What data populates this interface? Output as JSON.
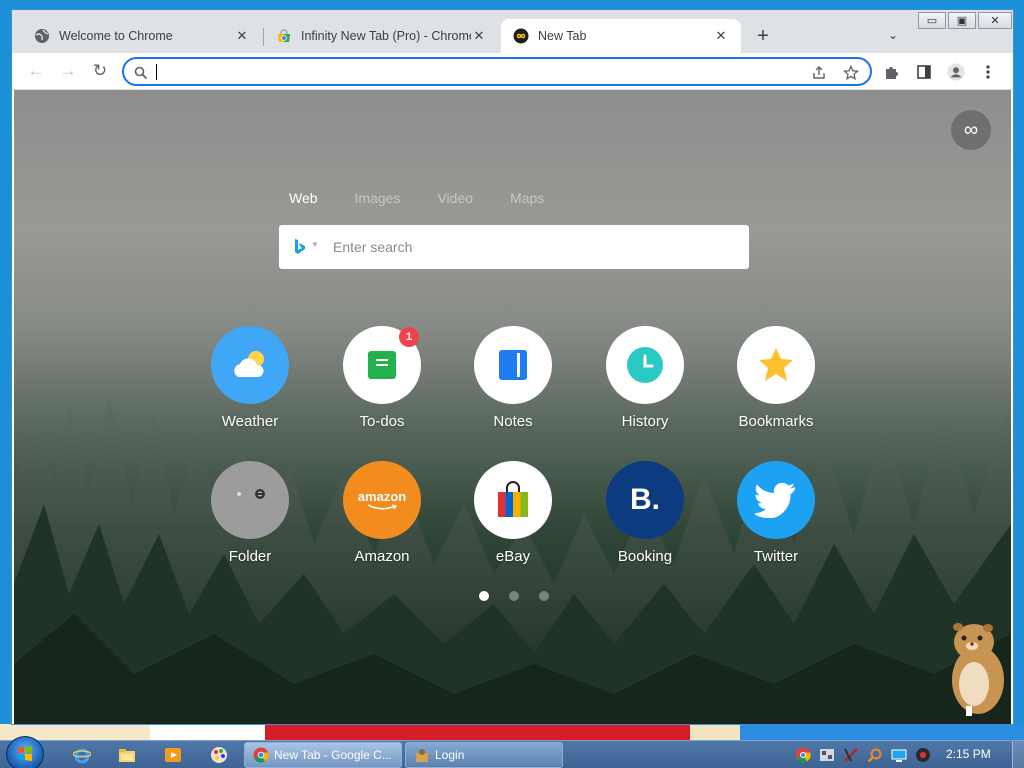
{
  "browser": {
    "tabs": [
      {
        "label": "Welcome to Chrome",
        "icon": "globe-icon"
      },
      {
        "label": "Infinity New Tab (Pro) - Chrome W",
        "icon": "chrome-webstore-icon"
      },
      {
        "label": "New Tab",
        "icon": "infinity-icon",
        "active": true
      }
    ],
    "new_tab_symbol": "+",
    "tab_search_symbol": "⌄",
    "window_controls": {
      "minimize": "▭",
      "maximize": "▣",
      "close": "✕"
    },
    "omnibox": {
      "value": "",
      "placeholder": ""
    }
  },
  "newtab": {
    "search_tabs": [
      "Web",
      "Images",
      "Video",
      "Maps"
    ],
    "active_search_tab": "Web",
    "search_placeholder": "Enter search",
    "infinity_symbol": "∞",
    "tiles": [
      {
        "label": "Weather",
        "icon": "weather-icon",
        "color": "#3fa7f5"
      },
      {
        "label": "To-dos",
        "icon": "todo-icon",
        "color": "#ffffff",
        "badge": "1"
      },
      {
        "label": "Notes",
        "icon": "notes-icon",
        "color": "#ffffff"
      },
      {
        "label": "History",
        "icon": "history-icon",
        "color": "#ffffff"
      },
      {
        "label": "Bookmarks",
        "icon": "bookmark-star-icon",
        "color": "#ffffff"
      },
      {
        "label": "Folder",
        "icon": "folder-icon",
        "color": "#9c9c9c"
      },
      {
        "label": "Amazon",
        "icon": "amazon-icon",
        "color": "#f28c1f",
        "text": "amazon"
      },
      {
        "label": "eBay",
        "icon": "ebay-icon",
        "color": "#ffffff"
      },
      {
        "label": "Booking",
        "icon": "booking-icon",
        "color": "#0c3b80",
        "text": "B."
      },
      {
        "label": "Twitter",
        "icon": "twitter-icon",
        "color": "#1da1f2"
      }
    ],
    "pages": 3,
    "current_page": 1
  },
  "taskbar": {
    "items": [
      {
        "label": "New Tab - Google C...",
        "icon": "chrome-icon",
        "active": true
      },
      {
        "label": "Login",
        "icon": "login-app-icon"
      }
    ],
    "clock": "2:15 PM"
  }
}
